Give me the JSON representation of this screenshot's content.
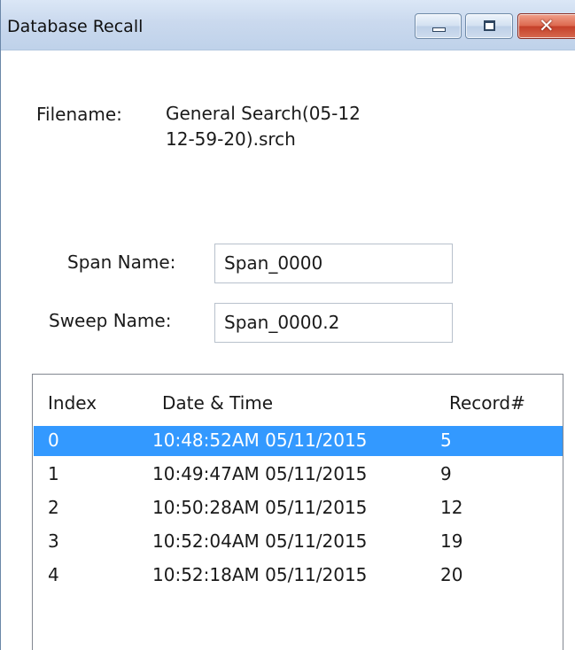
{
  "window": {
    "title": "Database Recall",
    "buttons": {
      "minimize": "minimize-icon",
      "maximize": "maximize-icon",
      "close": "close-icon"
    },
    "close_glyph": "✕"
  },
  "file": {
    "label": "Filename:",
    "value_line1": "General Search(05-12",
    "value_line2": "12-59-20).srch"
  },
  "span": {
    "label": "Span Name:",
    "value": "Span_0000"
  },
  "sweep": {
    "label": "Sweep Name:",
    "value": "Span_0000.2"
  },
  "records": {
    "columns": [
      "Index",
      "Date & Time",
      "Record#"
    ],
    "rows": [
      {
        "index": "0",
        "datetime": "10:48:52AM 05/11/2015",
        "record": "5"
      },
      {
        "index": "1",
        "datetime": "10:49:47AM 05/11/2015",
        "record": "9"
      },
      {
        "index": "2",
        "datetime": "10:50:28AM 05/11/2015",
        "record": "12"
      },
      {
        "index": "3",
        "datetime": "10:52:04AM 05/11/2015",
        "record": "19"
      },
      {
        "index": "4",
        "datetime": "10:52:18AM 05/11/2015",
        "record": "20"
      }
    ],
    "selected_index": 0
  },
  "colors": {
    "selection": "#3399ff",
    "titlebar": "#cad9ee",
    "close_button": "#c5402a"
  }
}
